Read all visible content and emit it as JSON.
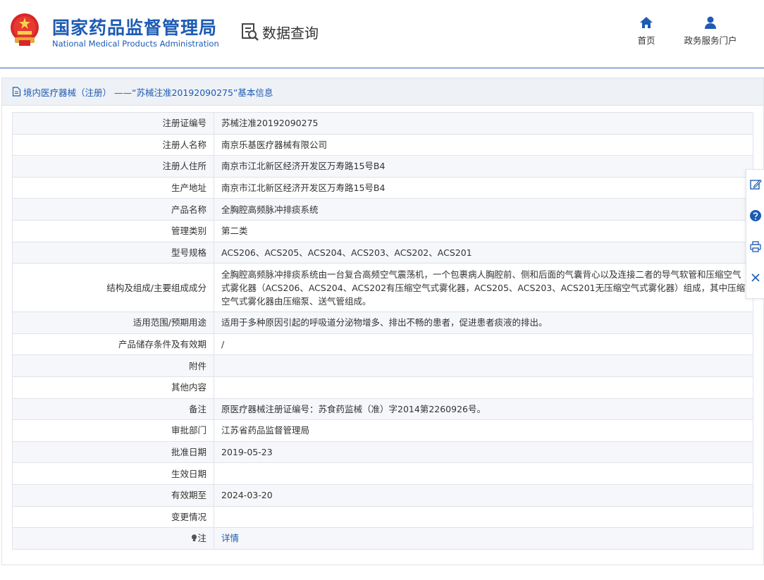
{
  "header": {
    "site_title_cn": "国家药品监督管理局",
    "site_title_en": "National Medical Products Administration",
    "section_title": "数据查询",
    "nav": [
      {
        "label": "首页",
        "icon": "home-icon"
      },
      {
        "label": "政务服务门户",
        "icon": "user-icon"
      }
    ]
  },
  "panel": {
    "title": "境内医疗器械（注册） ——“苏械注准20192090275”基本信息"
  },
  "fields": [
    {
      "label": "注册证编号",
      "value": "苏械注准20192090275"
    },
    {
      "label": "注册人名称",
      "value": "南京乐基医疗器械有限公司"
    },
    {
      "label": "注册人住所",
      "value": "南京市江北新区经济开发区万寿路15号B4"
    },
    {
      "label": "生产地址",
      "value": "南京市江北新区经济开发区万寿路15号B4"
    },
    {
      "label": "产品名称",
      "value": "全胸腔高频脉冲排痰系统"
    },
    {
      "label": "管理类别",
      "value": "第二类"
    },
    {
      "label": "型号规格",
      "value": "ACS206、ACS205、ACS204、ACS203、ACS202、ACS201"
    },
    {
      "label": "结构及组成/主要组成成分",
      "value": "全胸腔高频脉冲排痰系统由一台复合高频空气震荡机，一个包裹病人胸腔前、侧和后面的气囊背心以及连接二者的导气软管和压缩空气式雾化器（ACS206、ACS204、ACS202有压缩空气式雾化器，ACS205、ACS203、ACS201无压缩空气式雾化器）组成，其中压缩空气式雾化器由压缩泵、送气管组成。"
    },
    {
      "label": "适用范围/预期用途",
      "value": "适用于多种原因引起的呼吸道分泌物增多、排出不畅的患者，促进患者痰液的排出。"
    },
    {
      "label": "产品储存条件及有效期",
      "value": "/"
    },
    {
      "label": "附件",
      "value": ""
    },
    {
      "label": "其他内容",
      "value": ""
    },
    {
      "label": "备注",
      "value": "原医疗器械注册证编号：苏食药监械（准）字2014第2260926号。"
    },
    {
      "label": "审批部门",
      "value": "江苏省药品监督管理局"
    },
    {
      "label": "批准日期",
      "value": "2019-05-23"
    },
    {
      "label": "生效日期",
      "value": ""
    },
    {
      "label": "有效期至",
      "value": "2024-03-20"
    },
    {
      "label": "变更情况",
      "value": ""
    }
  ],
  "note": {
    "label": "注",
    "link_text": "详情",
    "icon": "lightbulb-icon"
  },
  "side_toolbar": [
    "edit-icon",
    "help-icon",
    "print-icon",
    "close-icon"
  ],
  "colors": {
    "brand_blue": "#1d5bb4",
    "row_alt": "#f5f7fa",
    "border": "#dfe3e8"
  }
}
